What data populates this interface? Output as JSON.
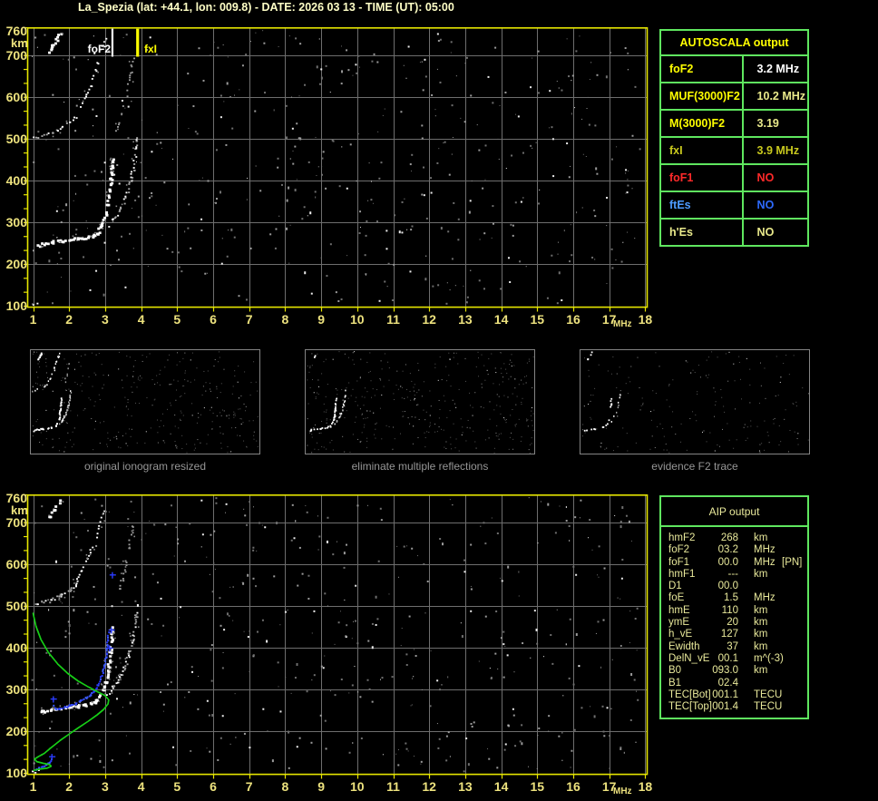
{
  "title": "La_Spezia (lat: +44.1, lon: 009.8) - DATE: 2026 03 13 - TIME (UT): 05:00",
  "colors": {
    "background": "#000000",
    "title_text": "#FFFFC6",
    "axis_label": "#EDE27E",
    "plot_frame": "#E6E600",
    "grid": "#6E6E6E",
    "trace_white": "#FFFFFF",
    "trace_gray": "#9A9A9A",
    "green_profile": "#17CE17",
    "blue_trace": "#2B3CFF",
    "table_border_green": "#5FE65F",
    "bright_yellow": "#FFFF00",
    "pale_yellow": "#E9E98B",
    "olive_yellow": "#C9C91E",
    "red": "#FF2A2A",
    "blue_label": "#4D9BFF",
    "blue_value": "#2E6BFF",
    "caption_gray": "#969696"
  },
  "ionogram": {
    "x_unit": "MHz",
    "y_unit": "km",
    "x_ticks": [
      "1",
      "2",
      "3",
      "4",
      "5",
      "6",
      "7",
      "8",
      "9",
      "10",
      "11",
      "12",
      "13",
      "14",
      "15",
      "16",
      "17",
      "18"
    ],
    "y_ticks": [
      [
        "760",
        760
      ],
      [
        "700",
        700
      ],
      [
        "600",
        600
      ],
      [
        "500",
        500
      ],
      [
        "400",
        400
      ],
      [
        "300",
        300
      ],
      [
        "200",
        200
      ],
      [
        "100",
        100
      ]
    ],
    "x_range": [
      1,
      18
    ],
    "y_range": [
      100,
      760
    ],
    "annotations": {
      "foF2_label": "foF2",
      "fxI_label": "fxI",
      "foF2_mhz": 3.2,
      "fxI_mhz": 3.9
    }
  },
  "autoscala": {
    "header": "AUTOSCALA output",
    "rows": [
      {
        "label": "foF2",
        "value": "3.2 MHz",
        "lc": "#FFFF00",
        "vc": "#FFFFFF"
      },
      {
        "label": "MUF(3000)F2",
        "value": "10.2 MHz",
        "lc": "#FFFF00",
        "vc": "#E9E98B"
      },
      {
        "label": "M(3000)F2",
        "value": "3.19",
        "lc": "#FFFF00",
        "vc": "#E9E98B"
      },
      {
        "label": "fxI",
        "value": "3.9 MHz",
        "lc": "#C9C91E",
        "vc": "#C9C91E"
      },
      {
        "label": "foF1",
        "value": "NO",
        "lc": "#FF2A2A",
        "vc": "#FF2A2A"
      },
      {
        "label": "ftEs",
        "value": "NO",
        "lc": "#4D9BFF",
        "vc": "#2E6BFF"
      },
      {
        "label": "h'Es",
        "value": "NO",
        "lc": "#E9E98B",
        "vc": "#E9E98B"
      }
    ]
  },
  "aip": {
    "header": "AIP output",
    "rows": [
      {
        "param": "hmF2",
        "value": "268",
        "unit": "km",
        "extra": ""
      },
      {
        "param": "foF2",
        "value": "03.2",
        "unit": "MHz",
        "extra": ""
      },
      {
        "param": "foF1",
        "value": "00.0",
        "unit": "MHz",
        "extra": "[PN]"
      },
      {
        "param": "hmF1",
        "value": "---",
        "unit": "km",
        "extra": ""
      },
      {
        "param": "D1",
        "value": "00.0",
        "unit": "",
        "extra": ""
      },
      {
        "param": "foE",
        "value": "1.5",
        "unit": "MHz",
        "extra": ""
      },
      {
        "param": "hmE",
        "value": "110",
        "unit": "km",
        "extra": ""
      },
      {
        "param": "ymE",
        "value": "20",
        "unit": "km",
        "extra": ""
      },
      {
        "param": "h_vE",
        "value": "127",
        "unit": "km",
        "extra": ""
      },
      {
        "param": "Ewidth",
        "value": "37",
        "unit": "km",
        "extra": ""
      },
      {
        "param": "DelN_vE",
        "value": "00.1",
        "unit": "m^(-3)",
        "extra": ""
      },
      {
        "param": "B0",
        "value": "093.0",
        "unit": "km",
        "extra": ""
      },
      {
        "param": "B1",
        "value": "02.4",
        "unit": "",
        "extra": ""
      },
      {
        "param": "TEC[Bot]",
        "value": "001.1",
        "unit": "TECU",
        "extra": ""
      },
      {
        "param": "TEC[Top]",
        "value": "001.4",
        "unit": "TECU",
        "extra": ""
      }
    ]
  },
  "thumbnails": [
    {
      "caption": "original ionogram resized",
      "mode": 1,
      "noise_seed": 21,
      "noise_count": 330,
      "trace_indices": [
        0,
        1,
        2,
        3,
        4,
        5,
        6
      ]
    },
    {
      "caption": "eliminate multiple reflections",
      "mode": 2,
      "noise_seed": 22,
      "noise_count": 380,
      "trace_indices": [
        0,
        1,
        2,
        6
      ]
    },
    {
      "caption": "evidence F2 trace",
      "mode": 3,
      "noise_seed": 23,
      "noise_count": 190,
      "trace_indices": [
        0,
        1,
        2,
        6
      ]
    }
  ],
  "chart_data": [
    {
      "name": "ionogram-top",
      "type": "scatter",
      "xlabel": "MHz",
      "ylabel": "km",
      "x_range": [
        1,
        18
      ],
      "y_range": [
        100,
        760
      ],
      "grid": true,
      "foF2_line_mhz": 3.2,
      "fxI_line_mhz": 3.9,
      "traces": [
        {
          "name": "F2-first-hop-flat",
          "color": "white",
          "size": 3,
          "points": [
            [
              1.12,
              247
            ],
            [
              1.3,
              251
            ],
            [
              1.5,
              255
            ],
            [
              1.75,
              258
            ],
            [
              2.0,
              261
            ],
            [
              2.2,
              263
            ],
            [
              2.4,
              266
            ],
            [
              2.6,
              270
            ],
            [
              2.75,
              276
            ]
          ]
        },
        {
          "name": "F2-ordinary-asymptote",
          "color": "white",
          "size": 3,
          "points": [
            [
              2.75,
              276
            ],
            [
              2.88,
              295
            ],
            [
              2.98,
              318
            ],
            [
              3.05,
              345
            ],
            [
              3.1,
              375
            ],
            [
              3.13,
              405
            ],
            [
              3.16,
              435
            ],
            [
              3.18,
              455
            ]
          ]
        },
        {
          "name": "F2-extraordinary",
          "color": "mixed",
          "size": 2,
          "points": [
            [
              3.05,
              290
            ],
            [
              3.2,
              308
            ],
            [
              3.38,
              330
            ],
            [
              3.52,
              355
            ],
            [
              3.63,
              382
            ],
            [
              3.72,
              412
            ],
            [
              3.79,
              445
            ],
            [
              3.84,
              478
            ],
            [
              3.88,
              505
            ]
          ]
        },
        {
          "name": "second-hop-flat",
          "color": "mixed",
          "size": 2,
          "points": [
            [
              1.02,
              505
            ],
            [
              1.25,
              511
            ],
            [
              1.5,
              518
            ],
            [
              1.75,
              527
            ],
            [
              2.0,
              540
            ],
            [
              2.15,
              552
            ]
          ]
        },
        {
          "name": "second-hop-rise",
          "color": "white",
          "size": 2,
          "gap": 0.45,
          "points": [
            [
              2.15,
              552
            ],
            [
              2.35,
              588
            ],
            [
              2.55,
              625
            ],
            [
              2.7,
              660
            ],
            [
              2.82,
              695
            ],
            [
              2.93,
              725
            ],
            [
              3.02,
              752
            ]
          ]
        },
        {
          "name": "second-hop-extraordinary",
          "color": "gray",
          "size": 2,
          "gap": 0.55,
          "points": [
            [
              3.3,
              520
            ],
            [
              3.45,
              562
            ],
            [
              3.57,
              606
            ],
            [
              3.67,
              652
            ],
            [
              3.75,
              695
            ]
          ]
        },
        {
          "name": "top-left-streak",
          "color": "white",
          "size": 3,
          "points": [
            [
              1.42,
              710
            ],
            [
              1.52,
              724
            ],
            [
              1.62,
              740
            ],
            [
              1.72,
              754
            ]
          ]
        },
        {
          "name": "bottom-left-mark",
          "color": "white",
          "size": 2,
          "points": [
            [
              0.99,
              104
            ],
            [
              1.12,
              108
            ]
          ]
        }
      ],
      "noise": {
        "seed": 7,
        "count": 480
      }
    },
    {
      "name": "ionogram-bottom",
      "type": "scatter+line",
      "xlabel": "MHz",
      "ylabel": "km",
      "x_range": [
        1,
        18
      ],
      "y_range": [
        100,
        760
      ],
      "grid": true,
      "uses_traces_of": "ionogram-top",
      "green_profile": [
        [
          1.0,
          483
        ],
        [
          1.08,
          452
        ],
        [
          1.22,
          420
        ],
        [
          1.42,
          390
        ],
        [
          1.68,
          362
        ],
        [
          1.95,
          340
        ],
        [
          2.25,
          321
        ],
        [
          2.55,
          306
        ],
        [
          2.82,
          294
        ],
        [
          3.0,
          286
        ],
        [
          3.1,
          276
        ],
        [
          3.08,
          266
        ],
        [
          2.96,
          253
        ],
        [
          2.78,
          240
        ],
        [
          2.52,
          224
        ],
        [
          2.24,
          208
        ],
        [
          1.97,
          192
        ],
        [
          1.74,
          178
        ],
        [
          1.55,
          165
        ],
        [
          1.45,
          158
        ],
        [
          1.3,
          147
        ],
        [
          1.15,
          140
        ],
        [
          1.04,
          134
        ],
        [
          1.1,
          128
        ],
        [
          1.28,
          124
        ],
        [
          1.46,
          121
        ],
        [
          1.5,
          117
        ],
        [
          1.38,
          112
        ],
        [
          1.18,
          110
        ],
        [
          1.02,
          107
        ]
      ],
      "blue_trace_e": [
        [
          1.05,
          111
        ],
        [
          1.15,
          114
        ],
        [
          1.25,
          118
        ],
        [
          1.35,
          122
        ],
        [
          1.44,
          128
        ],
        [
          1.5,
          136
        ]
      ],
      "blue_trace_f": [
        [
          1.55,
          263
        ],
        [
          1.63,
          256
        ],
        [
          1.73,
          257
        ],
        [
          1.85,
          260
        ],
        [
          2.0,
          264
        ],
        [
          2.15,
          269
        ],
        [
          2.3,
          275
        ],
        [
          2.45,
          282
        ],
        [
          2.57,
          290
        ],
        [
          2.68,
          300
        ],
        [
          2.77,
          312
        ],
        [
          2.85,
          326
        ],
        [
          2.91,
          342
        ],
        [
          2.96,
          360
        ],
        [
          3.0,
          380
        ],
        [
          3.03,
          400
        ],
        [
          3.05,
          420
        ],
        [
          3.07,
          438
        ]
      ],
      "blue_markers": [
        [
          1.52,
          140
        ],
        [
          1.56,
          278
        ],
        [
          3.12,
          400
        ],
        [
          3.17,
          443
        ],
        [
          3.2,
          575
        ]
      ],
      "noise": {
        "seed": 13,
        "count": 480
      }
    }
  ]
}
